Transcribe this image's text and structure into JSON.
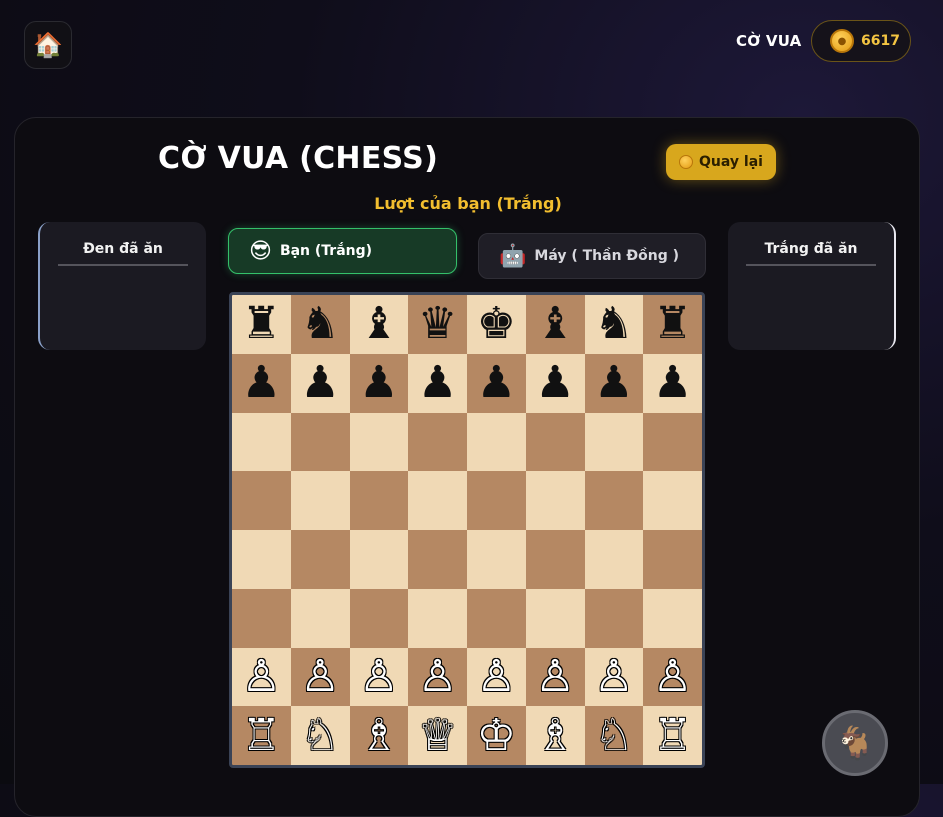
{
  "header": {
    "home_icon": "🏠",
    "game_name": "CỜ VUA",
    "coins": "6617"
  },
  "game": {
    "title": "CỜ VUA (CHESS)",
    "back_label": "Quay lại",
    "turn": "Lượt của bạn (Trắng)",
    "black_captured_label": "Đen đã ăn",
    "white_captured_label": "Trắng đã ăn",
    "player_you": {
      "avatar": "😎",
      "label": "Bạn (Trắng)"
    },
    "player_bot": {
      "avatar": "🤖",
      "label": "Máy (  Thần Đồng  )"
    }
  },
  "board": [
    [
      "♜",
      "♞",
      "♝",
      "♛",
      "♚",
      "♝",
      "♞",
      "♜"
    ],
    [
      "♟",
      "♟",
      "♟",
      "♟",
      "♟",
      "♟",
      "♟",
      "♟"
    ],
    [
      "",
      "",
      "",
      "",
      "",
      "",
      "",
      ""
    ],
    [
      "",
      "",
      "",
      "",
      "",
      "",
      "",
      ""
    ],
    [
      "",
      "",
      "",
      "",
      "",
      "",
      "",
      ""
    ],
    [
      "",
      "",
      "",
      "",
      "",
      "",
      "",
      ""
    ],
    [
      "♙",
      "♙",
      "♙",
      "♙",
      "♙",
      "♙",
      "♙",
      "♙"
    ],
    [
      "♖",
      "♘",
      "♗",
      "♕",
      "♔",
      "♗",
      "♘",
      "♖"
    ]
  ],
  "mascot_icon": "🐐",
  "colors": {
    "accent_gold": "#d8a71d",
    "turn_text": "#f2be2f",
    "active_player": "#34c06a",
    "light_square": "#f0d9b5",
    "dark_square": "#b58863"
  }
}
